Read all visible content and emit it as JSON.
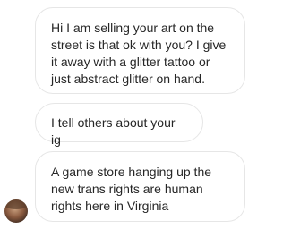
{
  "messages": [
    {
      "text": "Hi I am selling your art on the\nstreet is that ok with you? I give\nit away with a glitter tattoo or\njust abstract glitter on hand."
    },
    {
      "text": "I tell others about your ig"
    },
    {
      "text": "A game store hanging up the\nnew trans rights are human\nrights here in Virginia"
    }
  ],
  "sender": {
    "avatar_icon": "profile-photo-avatar"
  },
  "colors": {
    "bubble_border": "#e6e6e6",
    "bubble_background": "#ffffff",
    "text": "#262626"
  }
}
